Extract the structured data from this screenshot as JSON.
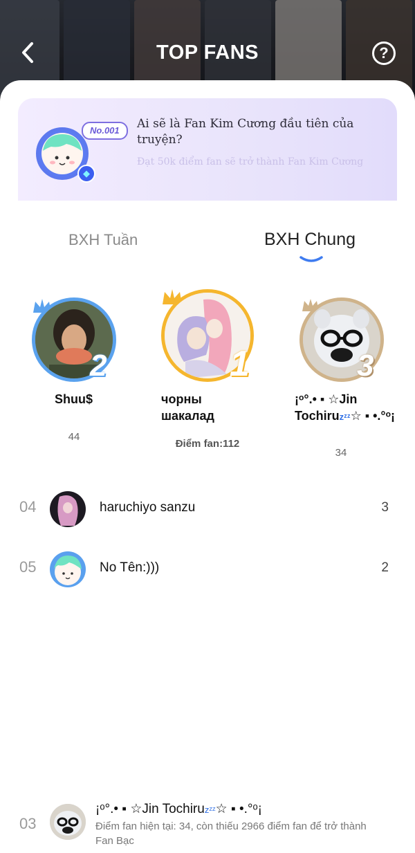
{
  "header": {
    "title": "TOP FANS",
    "back_icon": "chevron-left-icon",
    "help_icon": "help-circle-icon",
    "help_glyph": "?"
  },
  "promo": {
    "badge": "No.001",
    "title": "Ai sẽ là Fan Kim Cương đầu tiên của truyện?",
    "subtitle": "Đạt 50k điểm fan sẽ trở thành Fan Kim Cương"
  },
  "tabs": [
    {
      "label": "BXH Tuần",
      "active": false
    },
    {
      "label": "BXH Chung",
      "active": true
    }
  ],
  "podium": {
    "second": {
      "rank": "2",
      "name": "Shuu$",
      "score": "44"
    },
    "first": {
      "rank": "1",
      "name": "чорны шакалад",
      "score": "Điểm fan:112"
    },
    "third": {
      "rank": "3",
      "name": "¡ᵒ°.• ▪ ☆Jin Tochiru",
      "name_suffix": "zᶻᶻ",
      "name_tail": "☆ ▪ •.°ᵒ¡",
      "score": "34"
    }
  },
  "list": [
    {
      "rank": "04",
      "name": "haruchiyo sanzu",
      "score": "3"
    },
    {
      "rank": "05",
      "name": "No Tên:)))",
      "score": "2"
    }
  ],
  "me": {
    "rank": "03",
    "name": "¡ᵒ°.• ▪ ☆Jin Tochiru",
    "name_suffix": "zᶻᶻ",
    "name_tail": "☆ ▪ •.°ᵒ¡",
    "note": "Điểm fan hiện tại: 34, còn thiếu 2966 điểm fan để trở thành Fan Bạc"
  },
  "colors": {
    "gold": "#f5b62e",
    "silver_blue": "#5aa2ee",
    "bronze": "#cfb38a",
    "accent": "#3f7cf0"
  }
}
